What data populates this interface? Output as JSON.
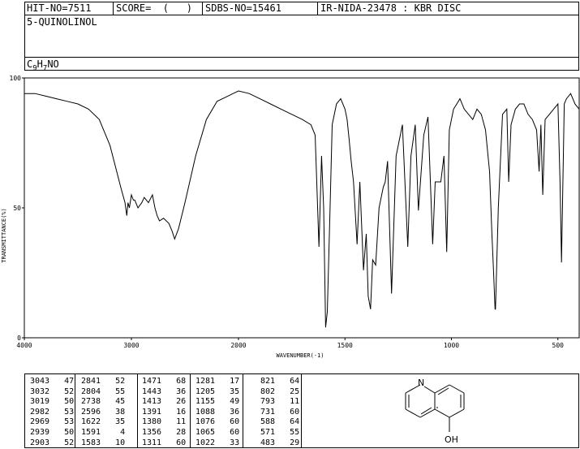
{
  "header": {
    "hit_no": "HIT-NO=7511",
    "score": "SCORE=  (   )",
    "sdbs_no": "SDBS-NO=15461",
    "ir_nida": "IR-NIDA-23478 : KBR DISC",
    "compound_name": "5-QUINOLINOL",
    "formula_c": "C",
    "formula_9": "9",
    "formula_h": "H",
    "formula_7": "7",
    "formula_no": "NO"
  },
  "chart_data": {
    "type": "line",
    "xlabel": "WAVENUMBER(-1)",
    "ylabel": "TRANSMITTANCE(%)",
    "xlim": [
      4000,
      400
    ],
    "ylim": [
      0,
      100
    ],
    "xticks": [
      4000,
      3000,
      2000,
      1500,
      1000,
      500
    ],
    "yticks": [
      0,
      50,
      100
    ],
    "xtick_labels": [
      "4000",
      "3000",
      "2000",
      "1500",
      "1000",
      "500"
    ],
    "ytick_labels": [
      "0",
      "50",
      "100"
    ],
    "series": [
      {
        "x": [
          4000,
          3900,
          3800,
          3700,
          3600,
          3500,
          3400,
          3300,
          3200,
          3150,
          3100,
          3060,
          3043,
          3032,
          3019,
          3000,
          2982,
          2969,
          2939,
          2903,
          2880,
          2841,
          2804,
          2780,
          2760,
          2738,
          2700,
          2650,
          2620,
          2596,
          2560,
          2500,
          2400,
          2300,
          2200,
          2100,
          2050,
          2000,
          1950,
          1900,
          1850,
          1800,
          1750,
          1700,
          1660,
          1640,
          1622,
          1610,
          1600,
          1591,
          1583,
          1570,
          1560,
          1540,
          1520,
          1500,
          1490,
          1480,
          1471,
          1460,
          1443,
          1430,
          1413,
          1400,
          1391,
          1380,
          1370,
          1356,
          1340,
          1320,
          1311,
          1300,
          1281,
          1260,
          1230,
          1205,
          1190,
          1170,
          1155,
          1130,
          1110,
          1088,
          1076,
          1065,
          1050,
          1035,
          1022,
          1010,
          990,
          975,
          960,
          940,
          900,
          880,
          860,
          840,
          821,
          810,
          802,
          795,
          793,
          780,
          760,
          740,
          731,
          720,
          700,
          680,
          660,
          640,
          620,
          600,
          588,
          580,
          571,
          560,
          540,
          520,
          500,
          490,
          483,
          470,
          460,
          440,
          420,
          400
        ],
        "y": [
          94,
          94,
          93,
          92,
          91,
          90,
          88,
          84,
          74,
          66,
          58,
          52,
          47,
          52,
          50,
          55,
          53,
          53,
          50,
          52,
          54,
          52,
          55,
          50,
          47,
          45,
          46,
          44,
          41,
          38,
          42,
          52,
          70,
          84,
          91,
          93,
          94,
          95,
          94,
          92,
          90,
          88,
          86,
          84,
          82,
          78,
          35,
          70,
          50,
          4,
          10,
          50,
          82,
          90,
          92,
          88,
          84,
          76,
          68,
          60,
          36,
          60,
          26,
          40,
          16,
          11,
          30,
          28,
          50,
          58,
          60,
          68,
          17,
          70,
          82,
          35,
          70,
          82,
          49,
          78,
          85,
          36,
          60,
          60,
          60,
          70,
          33,
          80,
          88,
          90,
          92,
          88,
          84,
          88,
          86,
          80,
          64,
          40,
          25,
          11,
          11,
          50,
          86,
          88,
          60,
          82,
          88,
          90,
          90,
          86,
          84,
          80,
          64,
          82,
          55,
          84,
          86,
          88,
          90,
          60,
          29,
          90,
          92,
          94,
          90,
          88
        ]
      }
    ]
  },
  "peak_columns": [
    [
      [
        "3043",
        "47"
      ],
      [
        "3032",
        "52"
      ],
      [
        "3019",
        "50"
      ],
      [
        "2982",
        "53"
      ],
      [
        "2969",
        "53"
      ],
      [
        "2939",
        "50"
      ],
      [
        "2903",
        "52"
      ]
    ],
    [
      [
        "2841",
        "52"
      ],
      [
        "2804",
        "55"
      ],
      [
        "2738",
        "45"
      ],
      [
        "2596",
        "38"
      ],
      [
        "1622",
        "35"
      ],
      [
        "1591",
        "4"
      ],
      [
        "1583",
        "10"
      ]
    ],
    [
      [
        "1471",
        "68"
      ],
      [
        "1443",
        "36"
      ],
      [
        "1413",
        "26"
      ],
      [
        "1391",
        "16"
      ],
      [
        "1380",
        "11"
      ],
      [
        "1356",
        "28"
      ],
      [
        "1311",
        "60"
      ]
    ],
    [
      [
        "1281",
        "17"
      ],
      [
        "1205",
        "35"
      ],
      [
        "1155",
        "49"
      ],
      [
        "1088",
        "36"
      ],
      [
        "1076",
        "60"
      ],
      [
        "1065",
        "60"
      ],
      [
        "1022",
        "33"
      ]
    ],
    [
      [
        "821",
        "64"
      ],
      [
        "802",
        "25"
      ],
      [
        "793",
        "11"
      ],
      [
        "731",
        "60"
      ],
      [
        "588",
        "64"
      ],
      [
        "571",
        "55"
      ],
      [
        "483",
        "29"
      ]
    ]
  ],
  "molecule": {
    "n_label": "N",
    "oh_label": "OH"
  }
}
